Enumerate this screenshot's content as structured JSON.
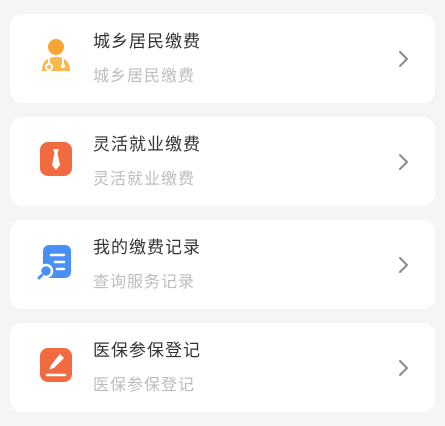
{
  "items": [
    {
      "title": "城乡居民缴费",
      "subtitle": "城乡居民缴费",
      "icon": "resident-avatar-icon",
      "color": "#f7a534"
    },
    {
      "title": "灵活就业缴费",
      "subtitle": "灵活就业缴费",
      "icon": "necktie-icon",
      "color": "#f26a3f"
    },
    {
      "title": "我的缴费记录",
      "subtitle": "查询服务记录",
      "icon": "record-search-icon",
      "color": "#4a8ff5"
    },
    {
      "title": "医保参保登记",
      "subtitle": "医保参保登记",
      "icon": "edit-pen-icon",
      "color": "#f26a3f"
    }
  ]
}
